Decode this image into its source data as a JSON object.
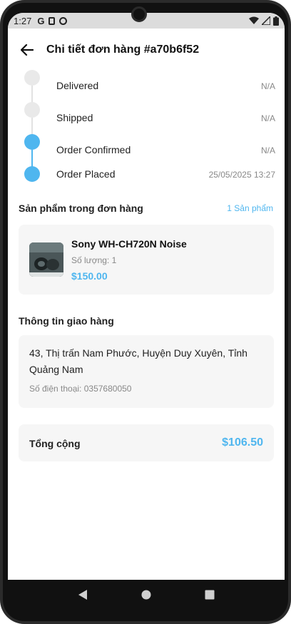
{
  "status_bar": {
    "time": "1:27",
    "left_icons": [
      "google-icon",
      "sd-card-icon",
      "at-sign-icon"
    ],
    "right_icons": [
      "wifi-icon",
      "signal-icon",
      "battery-icon"
    ]
  },
  "header": {
    "title": "Chi tiết đơn hàng #a70b6f52"
  },
  "timeline": {
    "steps": [
      {
        "label": "Delivered",
        "date": "N/A",
        "active": false
      },
      {
        "label": "Shipped",
        "date": "N/A",
        "active": false
      },
      {
        "label": "Order Confirmed",
        "date": "N/A",
        "active": true
      },
      {
        "label": "Order Placed",
        "date": "25/05/2025 13:27",
        "active": true
      }
    ]
  },
  "products": {
    "title": "Sản phẩm trong đơn hàng",
    "count_label": "1 Sản phẩm",
    "items": [
      {
        "name": "Sony WH-CH720N Noise",
        "quantity": "Số lượng: 1",
        "price": "$150.00"
      }
    ]
  },
  "shipping": {
    "title": "Thông tin giao hàng",
    "address": "43, Thị trấn Nam Phước, Huyện Duy Xuyên, Tỉnh Quảng Nam",
    "phone": "Số điện thoại: 0357680050"
  },
  "total": {
    "label": "Tổng cộng",
    "value": "$106.50"
  },
  "colors": {
    "accent": "#4fb6ef",
    "card_bg": "#f6f6f6",
    "inactive_dot": "#e9e9e9"
  }
}
